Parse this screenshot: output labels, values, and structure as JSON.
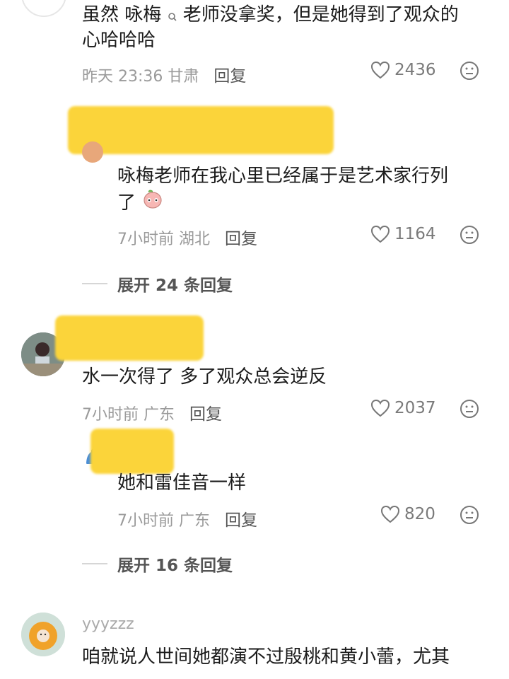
{
  "comments": [
    {
      "text_line1": "虽然 咏梅",
      "mention_icon": "search-icon",
      "text_line1b": "老师没拿奖，但是她得到了观众的",
      "text_line2": "心哈哈哈",
      "time": "昨天 23:36",
      "location": "甘肃",
      "reply_label": "回复",
      "likes": "2436"
    },
    {
      "text_line1": "咏梅老师在我心里已经属于是艺术家行列",
      "text_line2": "了",
      "time": "7小时前",
      "location": "湖北",
      "reply_label": "回复",
      "likes": "1164",
      "expand": "展开 24 条回复"
    },
    {
      "text": "水一次得了 多了观众总会逆反",
      "time": "7小时前",
      "location": "广东",
      "reply_label": "回复",
      "likes": "2037"
    },
    {
      "text": "她和雷佳音一样",
      "time": "7小时前",
      "location": "广东",
      "reply_label": "回复",
      "likes": "820",
      "expand": "展开 16 条回复"
    },
    {
      "username": "yyyzzz",
      "text_line1": "咱就说人世间她都演不过殷桃和黄小蕾，尤其"
    }
  ],
  "colors": {
    "redaction": "#fbd43a",
    "meta": "#9a9a9a"
  }
}
